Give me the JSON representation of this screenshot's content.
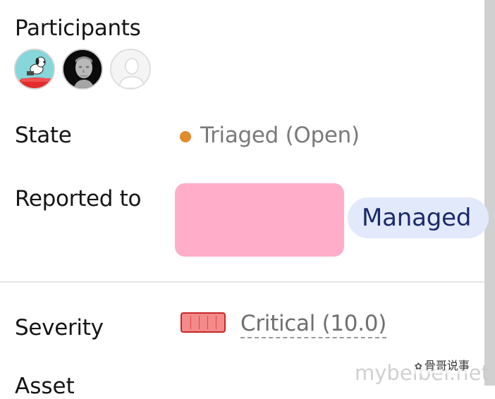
{
  "participants": {
    "label": "Participants",
    "avatars": [
      "snoopy-avatar",
      "bust-avatar",
      "default-avatar"
    ]
  },
  "state": {
    "label": "State",
    "value": "Triaged (Open)",
    "dot_color": "#e08a2b"
  },
  "reported_to": {
    "label": "Reported to",
    "badge": "Managed",
    "redacted_color": "#ffadc9"
  },
  "severity": {
    "label": "Severity",
    "value": "Critical (10.0)",
    "icon_color": "#f48a8a"
  },
  "watermark": {
    "site": "mybeibei.net",
    "brand": "骨哥说事",
    "icon": "wechat-icon"
  }
}
